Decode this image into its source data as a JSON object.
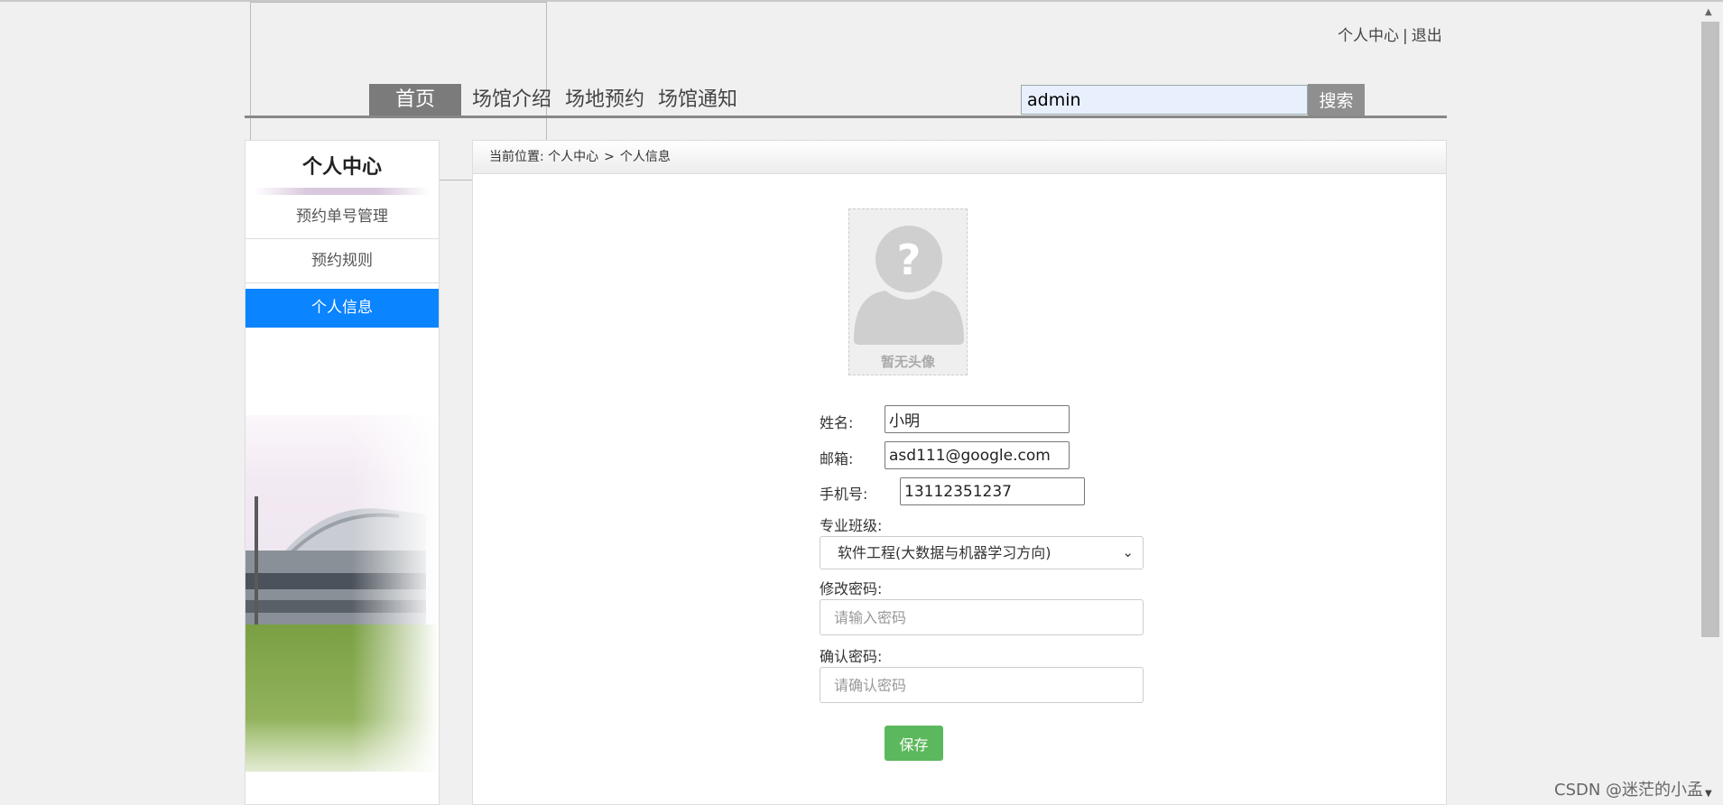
{
  "header": {
    "user_center": "个人中心",
    "separator": "|",
    "logout": "退出"
  },
  "nav": {
    "items": [
      "首页",
      "场馆介绍",
      "场地预约",
      "场馆通知"
    ],
    "active_index": 0
  },
  "search": {
    "value": "admin",
    "button": "搜索"
  },
  "sidebar": {
    "title": "个人中心",
    "items": [
      "预约单号管理",
      "预约规则",
      "个人信息"
    ],
    "active_index": 2
  },
  "breadcrumb": {
    "prefix": "当前位置:",
    "path": [
      "个人中心",
      "个人信息"
    ],
    "separator": ">"
  },
  "profile": {
    "avatar_text": "暂无头像",
    "name_label": "姓名:",
    "name_value": "小明",
    "email_label": "邮箱:",
    "email_value": "asd111@google.com",
    "phone_label": "手机号:",
    "phone_value": "13112351237",
    "class_label": "专业班级:",
    "class_value": "软件工程(大数据与机器学习方向)",
    "password_label": "修改密码:",
    "password_placeholder": "请输入密码",
    "confirm_label": "确认密码:",
    "confirm_placeholder": "请确认密码",
    "save_button": "保存"
  },
  "watermark": "CSDN @迷茫的小孟",
  "colors": {
    "active_nav": "#7b7b7b",
    "active_sidebar": "#0a84ff",
    "save_button": "#5cb85c",
    "search_button": "#8f8f8f"
  }
}
